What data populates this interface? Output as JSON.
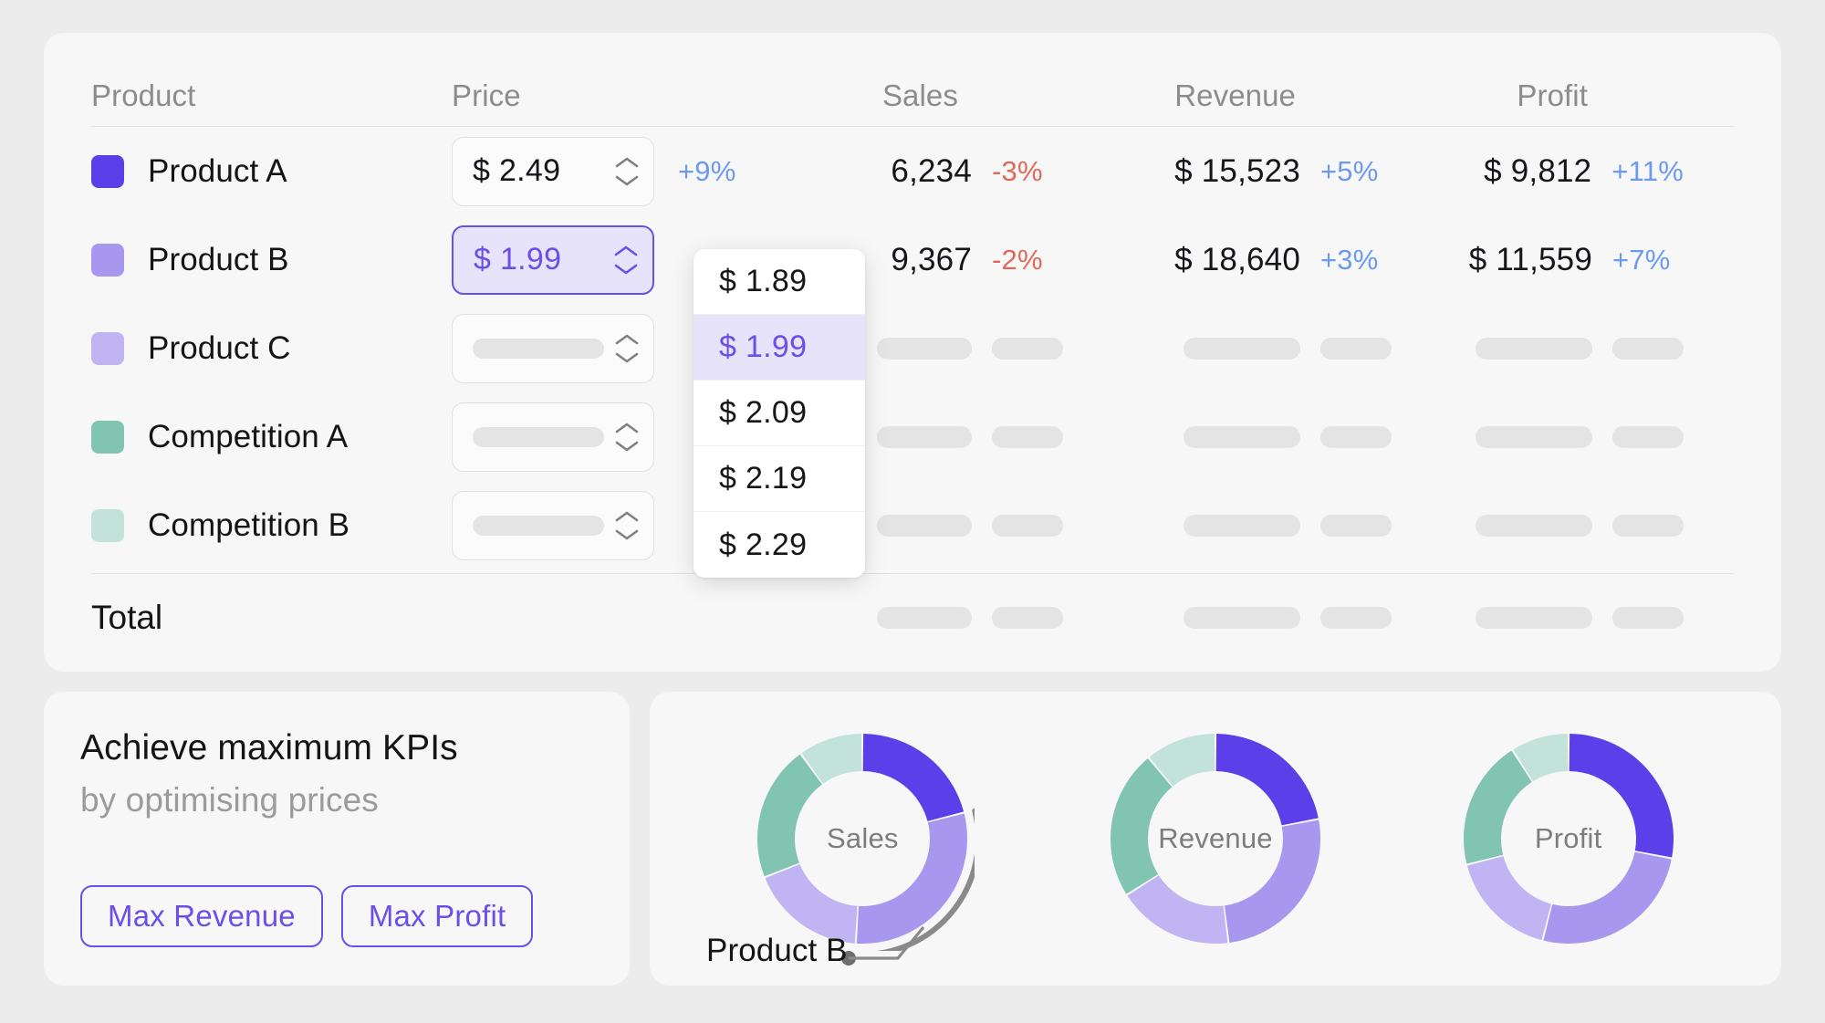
{
  "table": {
    "columns": [
      {
        "key": "product",
        "label": "Product"
      },
      {
        "key": "price",
        "label": "Price"
      },
      {
        "key": "sales",
        "label": "Sales"
      },
      {
        "key": "revenue",
        "label": "Revenue"
      },
      {
        "key": "profit",
        "label": "Profit"
      }
    ],
    "rows": [
      {
        "name": "Product A",
        "swatch": "#5b3fe8",
        "price": "$ 2.49",
        "price_state": "filled",
        "price_delta": "+9%",
        "price_delta_dir": "up",
        "sales": "6,234",
        "sales_delta": "-3%",
        "sales_delta_dir": "down",
        "revenue": "$ 15,523",
        "revenue_delta": "+5%",
        "revenue_delta_dir": "up",
        "profit": "$ 9,812",
        "profit_delta": "+11%",
        "profit_delta_dir": "up",
        "loading": false
      },
      {
        "name": "Product B",
        "swatch": "#a797ee",
        "price": "$ 1.99",
        "price_state": "active",
        "price_delta": "",
        "price_delta_dir": "",
        "sales": "9,367",
        "sales_delta": "-2%",
        "sales_delta_dir": "down",
        "revenue": "$ 18,640",
        "revenue_delta": "+3%",
        "revenue_delta_dir": "up",
        "profit": "$ 11,559",
        "profit_delta": "+7%",
        "profit_delta_dir": "up",
        "loading": false
      },
      {
        "name": "Product C",
        "swatch": "#c0b4f2",
        "price": "",
        "price_state": "skeleton",
        "price_delta": "",
        "price_delta_dir": "",
        "sales": "",
        "sales_delta": "",
        "sales_delta_dir": "",
        "revenue": "",
        "revenue_delta": "",
        "revenue_delta_dir": "",
        "profit": "",
        "profit_delta": "",
        "profit_delta_dir": "",
        "loading": true
      },
      {
        "name": "Competition A",
        "swatch": "#81c4b2",
        "price": "",
        "price_state": "skeleton",
        "price_delta": "",
        "price_delta_dir": "",
        "sales": "",
        "sales_delta": "",
        "sales_delta_dir": "",
        "revenue": "",
        "revenue_delta": "",
        "revenue_delta_dir": "",
        "profit": "",
        "profit_delta": "",
        "profit_delta_dir": "",
        "loading": true
      },
      {
        "name": "Competition B",
        "swatch": "#c3e2da",
        "price": "",
        "price_state": "skeleton",
        "price_delta": "",
        "price_delta_dir": "",
        "sales": "",
        "sales_delta": "",
        "sales_delta_dir": "",
        "revenue": "",
        "revenue_delta": "",
        "revenue_delta_dir": "",
        "profit": "",
        "profit_delta": "",
        "profit_delta_dir": "",
        "loading": true
      }
    ],
    "total_label": "Total",
    "total_loading": true
  },
  "price_dropdown": {
    "open": true,
    "options": [
      "$ 1.89",
      "$ 1.99",
      "$ 2.09",
      "$ 2.19",
      "$ 2.29"
    ],
    "selected": "$ 1.99"
  },
  "kpi": {
    "title": "Achieve maximum KPIs",
    "subtitle": "by optimising prices",
    "buttons": [
      {
        "label": "Max Revenue"
      },
      {
        "label": "Max Profit"
      }
    ]
  },
  "colors": {
    "accent": "#6c4ee8",
    "accent_soft": "#e7e3fb",
    "positive": "#6c9aee",
    "negative": "#e06a5a",
    "page_bg": "#ececec",
    "card_bg": "#f7f7f7",
    "skeleton": "#e4e4e4",
    "highlight_arc": "#8a8a8a"
  },
  "annotation": {
    "label": "Product B",
    "highlight_series": "Product B"
  },
  "chart_data": [
    {
      "type": "pie",
      "title": "Sales",
      "center_label": "Sales",
      "categories": [
        "Product A",
        "Product B",
        "Product C",
        "Competition A",
        "Competition B"
      ],
      "values": [
        21,
        30,
        18,
        21,
        10
      ],
      "colors": [
        "#5b3fe8",
        "#a797ee",
        "#c0b4f2",
        "#81c4b2",
        "#c3e2da"
      ],
      "highlighted": "Product B",
      "donut": true,
      "legend": "none"
    },
    {
      "type": "pie",
      "title": "Revenue",
      "center_label": "Revenue",
      "categories": [
        "Product A",
        "Product B",
        "Product C",
        "Competition A",
        "Competition B"
      ],
      "values": [
        22,
        26,
        18,
        23,
        11
      ],
      "colors": [
        "#5b3fe8",
        "#a797ee",
        "#c0b4f2",
        "#81c4b2",
        "#c3e2da"
      ],
      "highlighted": null,
      "donut": true,
      "legend": "none"
    },
    {
      "type": "pie",
      "title": "Profit",
      "center_label": "Profit",
      "categories": [
        "Product A",
        "Product B",
        "Product C",
        "Competition A",
        "Competition B"
      ],
      "values": [
        28,
        26,
        17,
        20,
        9
      ],
      "colors": [
        "#5b3fe8",
        "#a797ee",
        "#c0b4f2",
        "#81c4b2",
        "#c3e2da"
      ],
      "highlighted": null,
      "donut": true,
      "legend": "none"
    }
  ]
}
